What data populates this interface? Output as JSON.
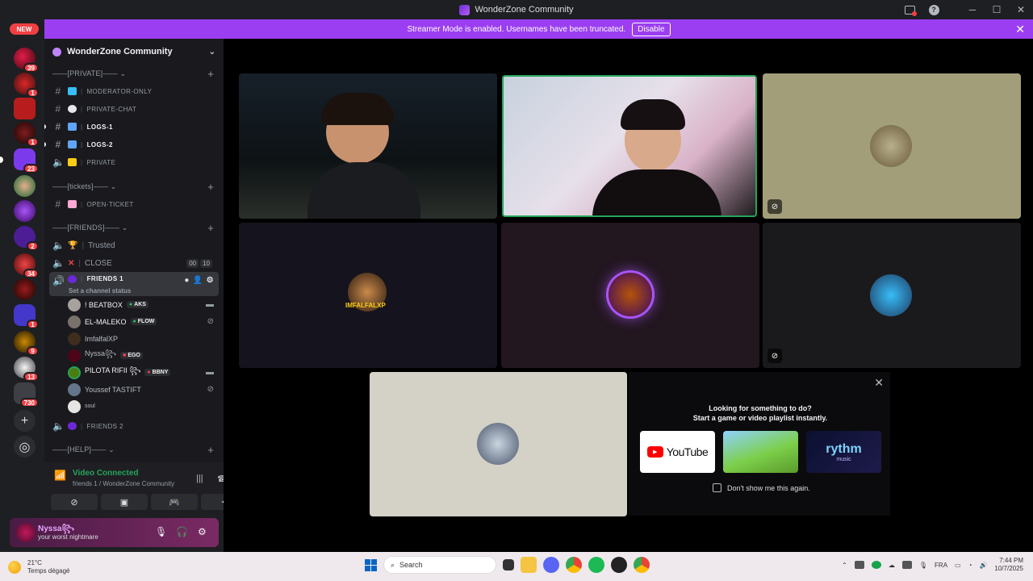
{
  "window": {
    "title": "WonderZone Community"
  },
  "serverbar": {
    "new_label": "NEW",
    "badges": [
      "39",
      "1",
      "1",
      "23",
      "2",
      "34",
      "1",
      "9",
      "13",
      "730"
    ]
  },
  "banner": {
    "text": "Streamer Mode is enabled. Usernames have been truncated.",
    "button": "Disable"
  },
  "guild": {
    "name": "WonderZone Community"
  },
  "categories": {
    "private": "——[PRIVATE]——",
    "tickets": "——[tickets]——",
    "friends": "——[FRIENDS]——",
    "help": "——[HELP]——"
  },
  "channels": {
    "moderator_only": "moderator-only",
    "private_chat": "private-chat",
    "logs1": "logs-1",
    "logs2": "logs-2",
    "private": "private",
    "open_ticket": "open-ticket",
    "trusted": "Trusted",
    "close": "CLOSE",
    "close_counts": [
      "00",
      "10"
    ],
    "friends1": "friends 1",
    "friends1_sub": "Set a channel status",
    "friends2": "friends 2"
  },
  "voice_users": [
    {
      "name": "! BEATBOX",
      "tag": "AKS"
    },
    {
      "name": "EL-MALEKO",
      "tag": "FLOW"
    },
    {
      "name": "ImfalfalXP",
      "tag": ""
    },
    {
      "name": "Nyssa꧂",
      "tag": "EGO"
    },
    {
      "name": "PILOTA RIFII ꧂",
      "tag": "BBNY"
    },
    {
      "name": "Youssef TASTIFT",
      "tag": ""
    },
    {
      "name": "soul",
      "tag": ""
    }
  ],
  "voice_panel": {
    "status": "Video Connected",
    "location": "friends 1 / WonderZone Community"
  },
  "user_panel": {
    "name": "Nyssa꧂",
    "status": "your worst nightmare"
  },
  "stage": {
    "tile_labels": [
      "IMFALFALXP"
    ],
    "popup_line1": "Looking for something to do?",
    "popup_line2": "Start a game or video playlist instantly.",
    "popup_check": "Don't show me this again.",
    "activities": [
      "YouTube",
      "rythm"
    ],
    "activity_sub": "music"
  },
  "taskbar": {
    "temp": "21°C",
    "weather": "Temps dégagé",
    "search": "Search",
    "lang": "FRA",
    "time": "7:44 PM",
    "date": "10/7/2025"
  },
  "colors": {
    "accent": "#9b3ef2",
    "online": "#23a55a",
    "danger": "#f23f43"
  }
}
